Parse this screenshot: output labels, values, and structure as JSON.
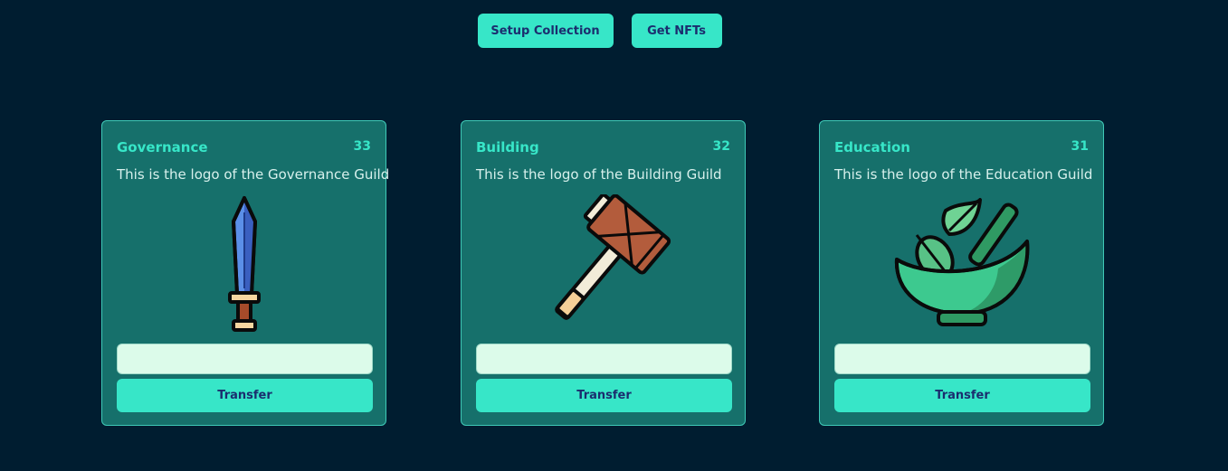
{
  "header": {
    "setup_label": "Setup Collection",
    "get_label": "Get NFTs"
  },
  "cards": [
    {
      "title": "Governance",
      "count": "33",
      "description": "This is the logo of the Governance Guild",
      "icon": "sword-icon",
      "input_value": "",
      "button_label": "Transfer"
    },
    {
      "title": "Building",
      "count": "32",
      "description": "This is the logo of the Building Guild",
      "icon": "hammer-icon",
      "input_value": "",
      "button_label": "Transfer"
    },
    {
      "title": "Education",
      "count": "31",
      "description": "This is the logo of the Education Guild",
      "icon": "mortar-pestle-icon",
      "input_value": "",
      "button_label": "Transfer"
    }
  ],
  "colors": {
    "background": "#001d30",
    "card": "#16706b",
    "accent": "#37e6c8",
    "button_text": "#1b2d6e",
    "input": "#dcfbea"
  }
}
